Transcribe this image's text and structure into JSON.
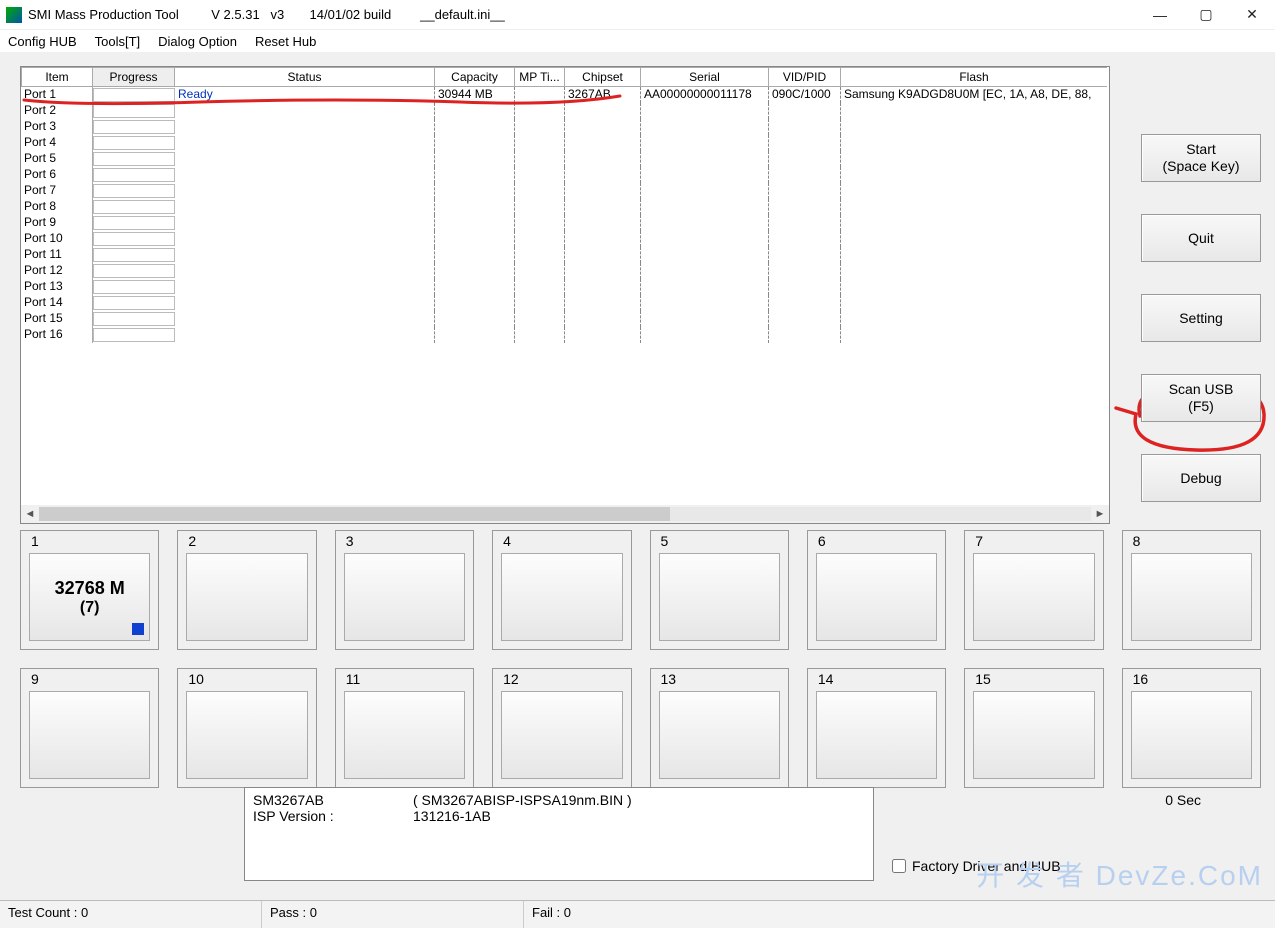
{
  "titlebar": {
    "title": "SMI Mass Production Tool         V 2.5.31   v3       14/01/02 build        __default.ini__"
  },
  "menu": [
    "Config HUB",
    "Tools[T]",
    "Dialog Option",
    "Reset Hub"
  ],
  "columns": [
    "Item",
    "Progress",
    "Status",
    "Capacity",
    "MP Ti...",
    "Chipset",
    "Serial",
    "VID/PID",
    "Flash"
  ],
  "rows": [
    {
      "item": "Port 1",
      "status": "Ready",
      "capacity": "30944 MB",
      "mpt": "",
      "chipset": "3267AB",
      "serial": "AA00000000011178",
      "vidpid": "090C/1000",
      "flash": "Samsung K9ADGD8U0M [EC, 1A, A8, DE, 88,"
    },
    {
      "item": "Port 2"
    },
    {
      "item": "Port 3"
    },
    {
      "item": "Port 4"
    },
    {
      "item": "Port 5"
    },
    {
      "item": "Port 6"
    },
    {
      "item": "Port 7"
    },
    {
      "item": "Port 8"
    },
    {
      "item": "Port 9"
    },
    {
      "item": "Port 10"
    },
    {
      "item": "Port 11"
    },
    {
      "item": "Port 12"
    },
    {
      "item": "Port 13"
    },
    {
      "item": "Port 14"
    },
    {
      "item": "Port 15"
    },
    {
      "item": "Port 16"
    }
  ],
  "sidebtns": {
    "start": "Start\n(Space Key)",
    "quit": "Quit",
    "setting": "Setting",
    "scan": "Scan USB\n(F5)",
    "debug": "Debug"
  },
  "tiles": {
    "t1": {
      "label": "1",
      "line1": "32768 M",
      "line2": "(7)",
      "active": true
    },
    "rest": [
      "2",
      "3",
      "4",
      "5",
      "6",
      "7",
      "8",
      "9",
      "10",
      "11",
      "12",
      "13",
      "14",
      "15",
      "16"
    ]
  },
  "info": {
    "chip": "SM3267AB",
    "bin": "( SM3267ABISP-ISPSA19nm.BIN )",
    "isp_label": "ISP Version :",
    "isp_ver": "131216-1AB"
  },
  "sec": "0 Sec",
  "factory_chk": "Factory Driver and HUB",
  "status": {
    "test": "Test Count : 0",
    "pass": "Pass : 0",
    "fail": "Fail : 0"
  },
  "watermark": "开 发 者 DevZe.CoM"
}
